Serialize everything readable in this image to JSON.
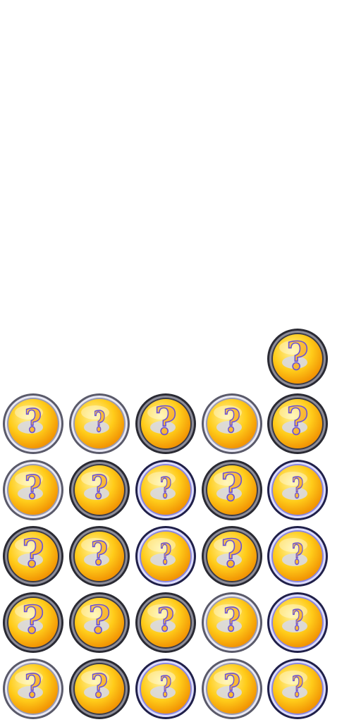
{
  "board": {
    "columns": 5,
    "rows": 6,
    "colors": {
      "background": "#ffffff",
      "coin_light": "#fff3a0",
      "coin_mid": "#ffcc1a",
      "coin_dark": "#f08c00",
      "question_fill": "#f5a623",
      "question_stroke": "#6a4fd8",
      "shadow_oval": "#d9d9e3"
    },
    "tiles": [
      {
        "row": 1,
        "col": 5,
        "symbol": "?",
        "frame": "dark",
        "style": "tall"
      },
      {
        "row": 2,
        "col": 1,
        "symbol": "?",
        "frame": "light",
        "style": "mid"
      },
      {
        "row": 2,
        "col": 2,
        "symbol": "?",
        "frame": "light",
        "style": "slim"
      },
      {
        "row": 2,
        "col": 3,
        "symbol": "?",
        "frame": "dark",
        "style": "tall"
      },
      {
        "row": 2,
        "col": 4,
        "symbol": "?",
        "frame": "light",
        "style": "mid"
      },
      {
        "row": 2,
        "col": 5,
        "symbol": "?",
        "frame": "dark",
        "style": "tall"
      },
      {
        "row": 3,
        "col": 1,
        "symbol": "?",
        "frame": "light",
        "style": "mid"
      },
      {
        "row": 3,
        "col": 2,
        "symbol": "?",
        "frame": "dark",
        "style": "mid"
      },
      {
        "row": 3,
        "col": 3,
        "symbol": "?",
        "frame": "blue",
        "style": "slim"
      },
      {
        "row": 3,
        "col": 4,
        "symbol": "?",
        "frame": "dark",
        "style": "tall"
      },
      {
        "row": 3,
        "col": 5,
        "symbol": "?",
        "frame": "blue",
        "style": "slim"
      },
      {
        "row": 4,
        "col": 1,
        "symbol": "?",
        "frame": "dark",
        "style": "tall"
      },
      {
        "row": 4,
        "col": 2,
        "symbol": "?",
        "frame": "dark",
        "style": "mid"
      },
      {
        "row": 4,
        "col": 3,
        "symbol": "?",
        "frame": "blue",
        "style": "slim"
      },
      {
        "row": 4,
        "col": 4,
        "symbol": "?",
        "frame": "dark",
        "style": "tall"
      },
      {
        "row": 4,
        "col": 5,
        "symbol": "?",
        "frame": "blue",
        "style": "slim"
      },
      {
        "row": 5,
        "col": 1,
        "symbol": "?",
        "frame": "dark",
        "style": "tall"
      },
      {
        "row": 5,
        "col": 2,
        "symbol": "?",
        "frame": "dark",
        "style": "tall"
      },
      {
        "row": 5,
        "col": 3,
        "symbol": "?",
        "frame": "dark",
        "style": "mid"
      },
      {
        "row": 5,
        "col": 4,
        "symbol": "?",
        "frame": "light",
        "style": "mid"
      },
      {
        "row": 5,
        "col": 5,
        "symbol": "?",
        "frame": "blue",
        "style": "slim"
      },
      {
        "row": 6,
        "col": 1,
        "symbol": "?",
        "frame": "light",
        "style": "mid"
      },
      {
        "row": 6,
        "col": 2,
        "symbol": "?",
        "frame": "dark",
        "style": "mid"
      },
      {
        "row": 6,
        "col": 3,
        "symbol": "?",
        "frame": "blue",
        "style": "slim"
      },
      {
        "row": 6,
        "col": 4,
        "symbol": "?",
        "frame": "light",
        "style": "mid"
      },
      {
        "row": 6,
        "col": 5,
        "symbol": "?",
        "frame": "blue",
        "style": "slim"
      }
    ]
  }
}
